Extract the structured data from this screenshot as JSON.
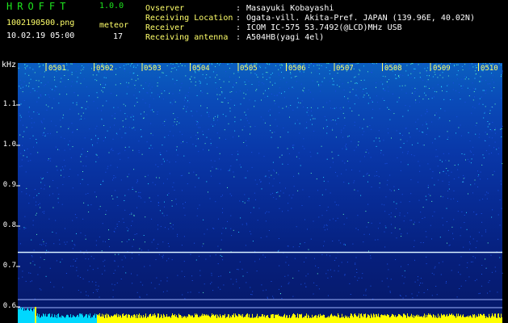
{
  "header": {
    "app_title": "HROFFT",
    "app_version": "1.0.0",
    "filename": "1002190500.png",
    "timestamp": "10.02.19 05:00",
    "meteor_label": "meteor",
    "meteor_count": "17"
  },
  "meta": [
    {
      "label": "Ovserver",
      "value": "Masayuki Kobayashi"
    },
    {
      "label": "Receiving Location",
      "value": "Ogata-vill. Akita-Pref. JAPAN (139.96E, 40.02N)"
    },
    {
      "label": "Receiver",
      "value": "ICOM IC-575 53.7492(@LCD)MHz USB"
    },
    {
      "label": "Receiving antenna",
      "value": "A504HB(yagi 4el)"
    }
  ],
  "separator": ":",
  "spectrogram": {
    "freq_unit": "kHz",
    "y_ticks": [
      "1.1",
      "1.0",
      "0.9",
      "0.8",
      "0.7",
      "0.6"
    ],
    "x_ticks": [
      "0501",
      "0502",
      "0503",
      "0504",
      "0505",
      "0506",
      "0507",
      "0508",
      "0509",
      "0510"
    ],
    "signal_freq_khz": 0.735,
    "colors": {
      "background": "#000000",
      "text_green": "#1ee61e",
      "text_yellow": "#ffff6a",
      "signal_line": "#d8f0ff",
      "level_cyan": "#00d8ff",
      "level_yellow": "#ffff00"
    }
  }
}
